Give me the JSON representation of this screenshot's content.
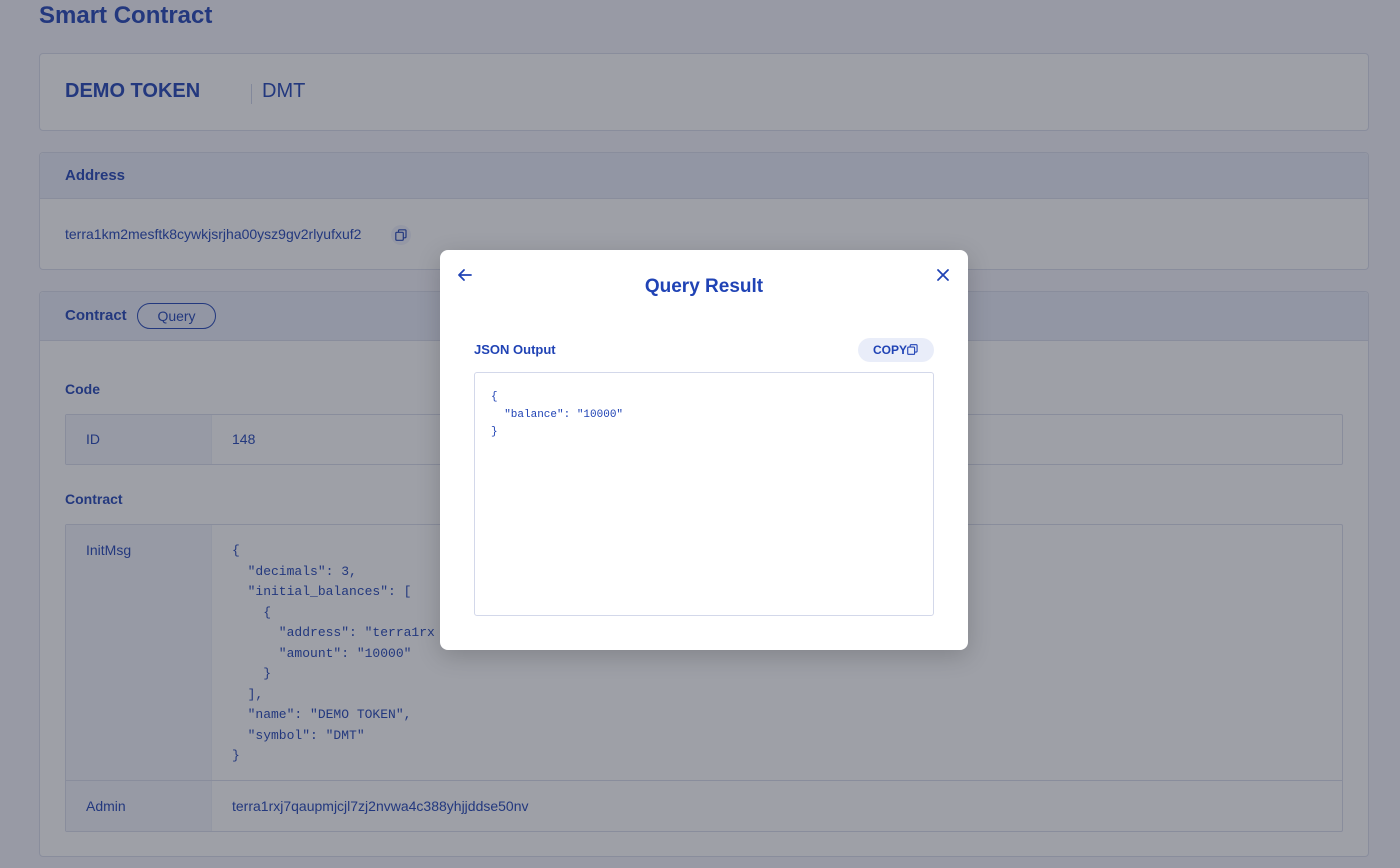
{
  "page": {
    "title": "Smart Contract"
  },
  "token": {
    "name": "DEMO TOKEN",
    "symbol": "DMT"
  },
  "address": {
    "heading": "Address",
    "value": "terra1km2mesftk8cywkjsrjha00ysz9gv2rlyufxuf2"
  },
  "contract": {
    "heading": "Contract",
    "query_label": "Query",
    "code_section": "Code",
    "id_label": "ID",
    "id_value": "148",
    "contract_section": "Contract",
    "initmsg_label": "InitMsg",
    "initmsg_value": "{\n  \"decimals\": 3,\n  \"initial_balances\": [\n    {\n      \"address\": \"terra1rx\n      \"amount\": \"10000\"\n    }\n  ],\n  \"name\": \"DEMO TOKEN\",\n  \"symbol\": \"DMT\"\n}",
    "admin_label": "Admin",
    "admin_value": "terra1rxj7qaupmjcjl7zj2nvwa4c388yhjjddse50nv"
  },
  "modal": {
    "title": "Query Result",
    "json_label": "JSON Output",
    "copy_label": "COPY",
    "json_output": "{\n  \"balance\": \"10000\"\n}"
  },
  "icons": {
    "back": "arrow-left-icon",
    "close": "close-icon",
    "copy": "copy-icon"
  },
  "colors": {
    "primary": "#2043b5",
    "header_bg": "#e9edf9",
    "overlay": "rgba(40,44,60,0.45)"
  }
}
